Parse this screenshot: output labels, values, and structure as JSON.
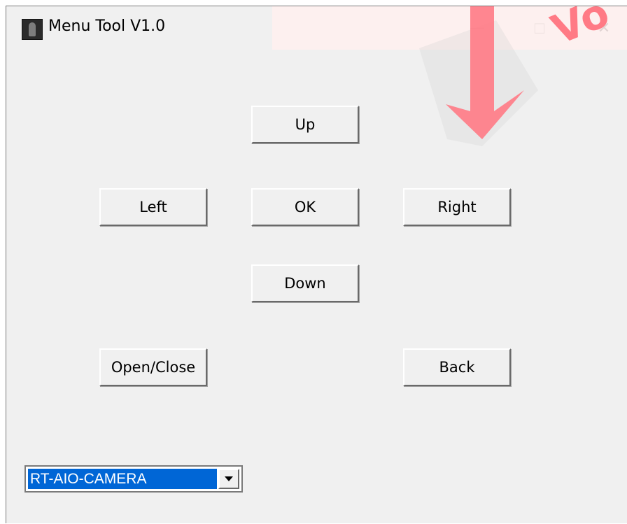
{
  "window": {
    "title": "Menu Tool V1.0",
    "controls": {
      "minimize": "—",
      "maximize": "☐",
      "close": "✕"
    }
  },
  "watermark": {
    "text": "Vo",
    "color": "#ff7a85"
  },
  "buttons": {
    "up": "Up",
    "left": "Left",
    "ok": "OK",
    "right": "Right",
    "down": "Down",
    "open_close": "Open/Close",
    "back": "Back"
  },
  "device_select": {
    "selected": "RT-AIO-CAMERA",
    "arrow_icon": "chevron-down-icon",
    "highlight_color": "#0066d6"
  },
  "colors": {
    "face": "#f0f0f0",
    "text": "#000000"
  }
}
